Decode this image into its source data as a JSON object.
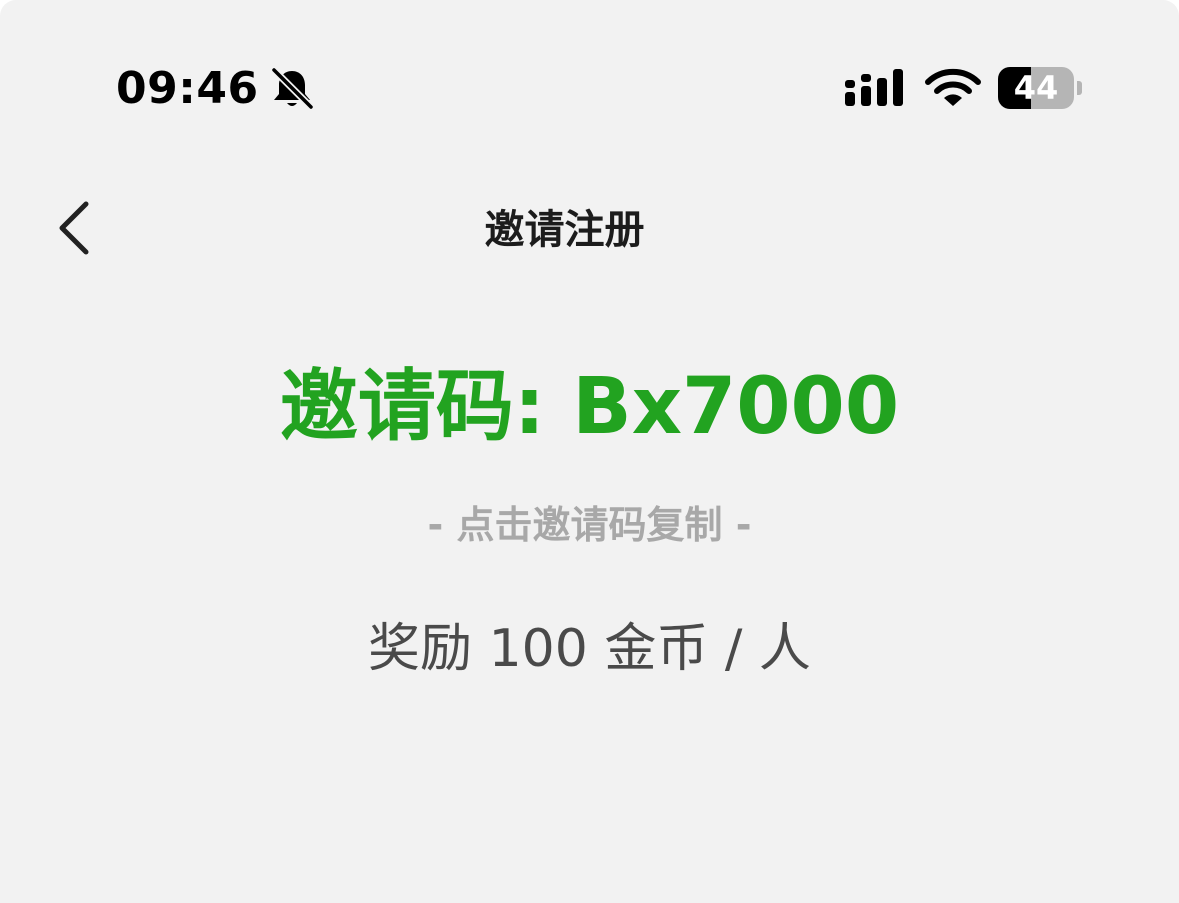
{
  "status_bar": {
    "time": "09:46",
    "battery_level": "44",
    "battery_fraction": 0.44,
    "icons": [
      "bell-muted-icon",
      "cellular-signal-icon",
      "wifi-icon",
      "battery-icon"
    ]
  },
  "nav": {
    "title": "邀请注册",
    "back_icon": "chevron-left-icon"
  },
  "content": {
    "invite_code": "邀请码: Bx7000",
    "copy_hint": "- 点击邀请码复制 -",
    "reward": "奖励 100 金币 / 人"
  },
  "colors": {
    "background": "#f2f2f2",
    "accent_green": "#22a320",
    "hint_gray": "#a8a8a8",
    "body_text": "#4a4a4a"
  }
}
